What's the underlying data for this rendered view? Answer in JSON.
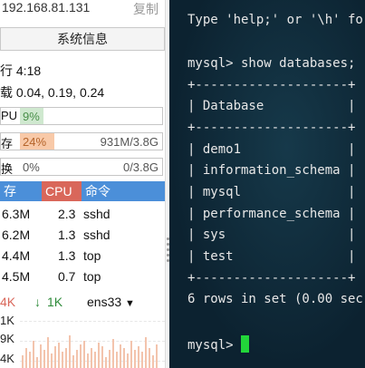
{
  "host": {
    "ip": "192.168.81.131",
    "copy_label": "复制"
  },
  "system_info_button": "系统信息",
  "uptime": "行 4:18",
  "load": "载 0.04, 0.19, 0.24",
  "cpu": {
    "label": "PU",
    "percent_text": "9%",
    "level": 0.09
  },
  "mem": {
    "label": "存",
    "percent_text": "24%",
    "usage_text": "931M/3.8G",
    "level": 0.24
  },
  "swap": {
    "label": "换",
    "percent_text": "0%",
    "usage_text": "0/3.8G",
    "level": 0.0
  },
  "process_table": {
    "headers": [
      "存",
      "CPU",
      "命令"
    ],
    "rows": [
      {
        "mem": "6.3M",
        "cpu": "2.3",
        "cmd": "sshd"
      },
      {
        "mem": "6.2M",
        "cpu": "1.3",
        "cmd": "sshd"
      },
      {
        "mem": "4.4M",
        "cpu": "1.3",
        "cmd": "top"
      },
      {
        "mem": "4.5M",
        "cpu": "0.7",
        "cmd": "top"
      }
    ]
  },
  "network": {
    "upload": "4K",
    "download_arrow": "↓",
    "download": "1K",
    "interface": "ens33"
  },
  "graph": {
    "y_labels": [
      "1K",
      "9K",
      "4K"
    ]
  },
  "terminal": {
    "lines": [
      "Type 'help;' or '\\h' fo",
      "",
      "mysql> show databases;",
      "+--------------------+",
      "| Database           |",
      "+--------------------+",
      "| demo1              |",
      "| information_schema |",
      "| mysql              |",
      "| performance_schema |",
      "| sys                |",
      "| test               |",
      "+--------------------+",
      "6 rows in set (0.00 sec",
      "",
      "mysql> "
    ],
    "prompt": "mysql> "
  },
  "colors": {
    "cpu_header": "#d9675a",
    "other_header": "#4b8fd9",
    "cpu_fill": "#cfe8cf",
    "mem_fill": "#f8c9a8",
    "cursor": "#22d63a"
  }
}
